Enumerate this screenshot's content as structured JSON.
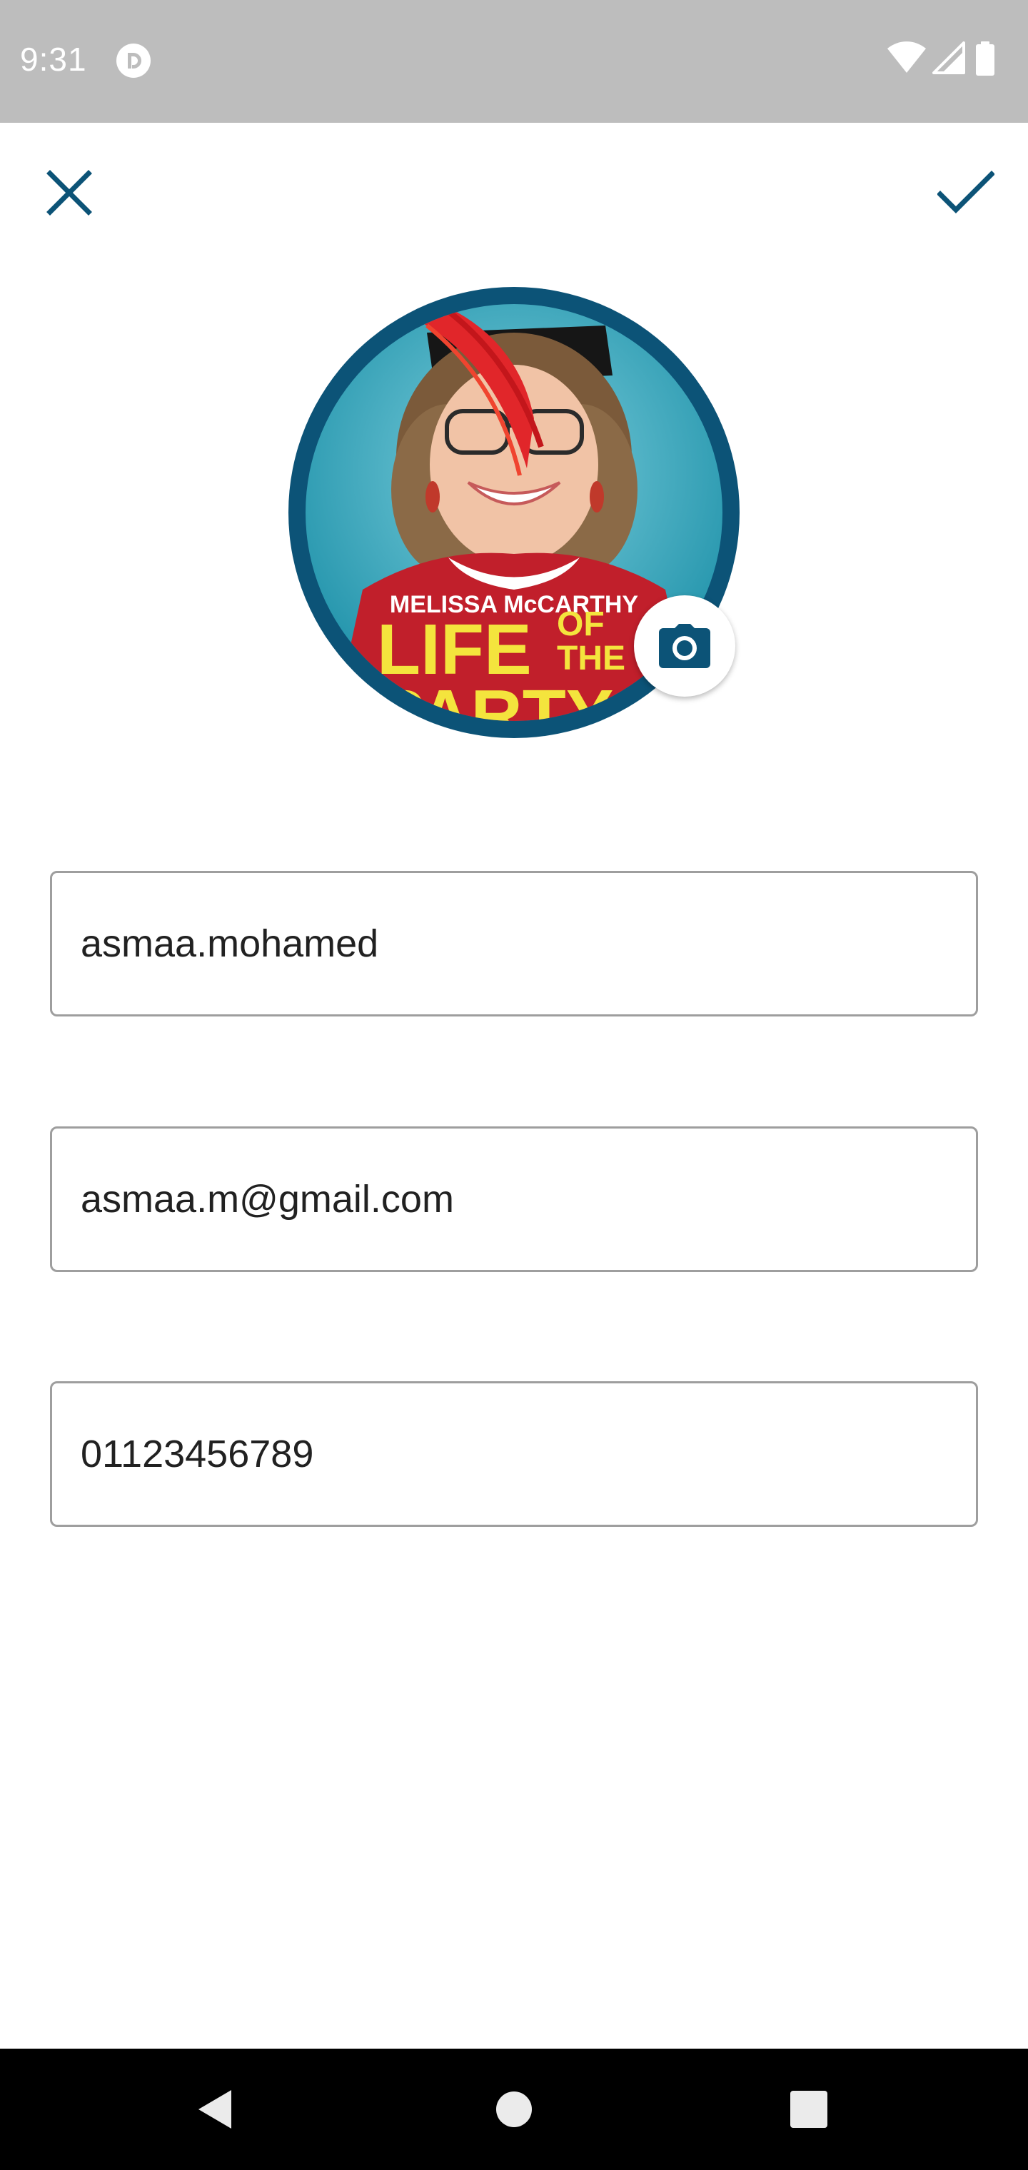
{
  "status_bar": {
    "time": "9:31",
    "app_icon": "pocket-casts-icon",
    "indicators": [
      "wifi-icon",
      "cell-signal-icon",
      "battery-icon"
    ]
  },
  "toolbar": {
    "close_icon": "close-icon",
    "confirm_icon": "checkmark-icon"
  },
  "profile": {
    "avatar_text_top": "MELISSA McCARTHY",
    "avatar_title_line1": "LIFE",
    "avatar_title_of": "OF",
    "avatar_title_the": "THE",
    "avatar_title_line2": "PARTY",
    "camera_icon": "camera-icon"
  },
  "form": {
    "username": "asmaa.mohamed",
    "email": "asmaa.m@gmail.com",
    "phone": "01123456789"
  },
  "nav_bar": {
    "back_icon": "back-triangle-icon",
    "home_icon": "home-circle-icon",
    "recents_icon": "recents-square-icon"
  },
  "colors": {
    "accent": "#0c5377",
    "status_bar": "#bdbdbd",
    "field_border": "#9e9e9e",
    "nav_bar": "#000000"
  }
}
